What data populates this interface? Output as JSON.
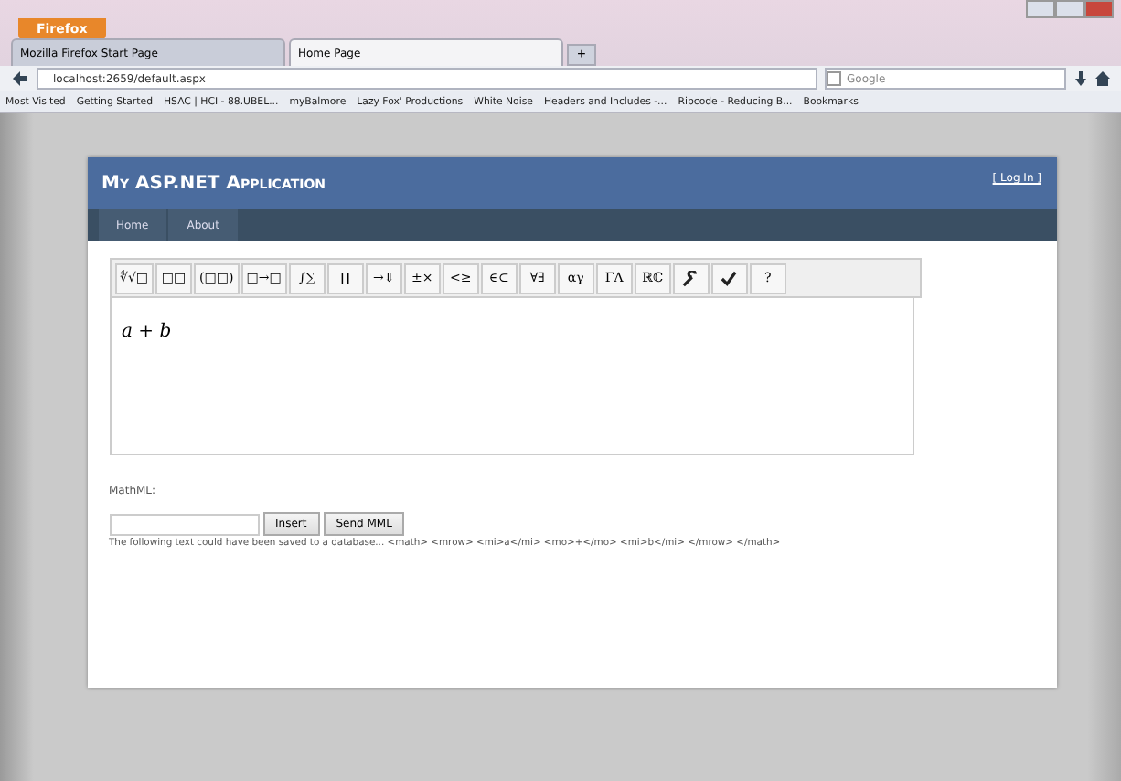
{
  "browser": {
    "menu_button": "Firefox",
    "tabs": [
      {
        "title": "Mozilla Firefox Start Page",
        "selected": false
      },
      {
        "title": "Home Page",
        "selected": true
      }
    ],
    "new_tab": "+",
    "url": "localhost:2659/default.aspx",
    "search_placeholder": "Google",
    "bookmarks": [
      "Most Visited",
      "Getting Started",
      "HSAC | HCI - 88.UBEL...",
      "myBalmore",
      "Lazy Fox' Productions",
      "White Noise",
      "Headers and Includes -...",
      "Ripcode - Reducing B..."
    ],
    "bookmarks_menu": "Bookmarks"
  },
  "site": {
    "title": "My ASP.NET Application",
    "login": "[ Log In ]",
    "nav": [
      {
        "label": "Home",
        "selected": false
      },
      {
        "label": "About",
        "selected": false
      }
    ]
  },
  "editor": {
    "toolbar": [
      {
        "kind": "text",
        "label": "∜√□"
      },
      {
        "kind": "text",
        "label": "□□"
      },
      {
        "kind": "text",
        "label": "(□□)"
      },
      {
        "kind": "text",
        "label": "□→□"
      },
      {
        "kind": "text",
        "label": "∫∑"
      },
      {
        "kind": "text",
        "label": "∏"
      },
      {
        "kind": "text",
        "label": "→⇓"
      },
      {
        "kind": "text",
        "label": "±×"
      },
      {
        "kind": "text",
        "label": "<≥"
      },
      {
        "kind": "text",
        "label": "∈⊂"
      },
      {
        "kind": "text",
        "label": "∀∃"
      },
      {
        "kind": "text",
        "label": "αγ"
      },
      {
        "kind": "text",
        "label": "ΓΛ"
      },
      {
        "kind": "text",
        "label": "ℝℂ"
      },
      {
        "kind": "wrench"
      },
      {
        "kind": "check"
      },
      {
        "kind": "text",
        "label": "?"
      }
    ],
    "formula": "*a* + *b*"
  },
  "mathml_label": "MathML:",
  "buttons": [
    "Insert",
    "Send MML"
  ],
  "output": "The following text could have been saved to a database... <math> <mrow> <mi>a</mi> <mo>+</mo> <mi>b</mi> </mrow> </math>"
}
